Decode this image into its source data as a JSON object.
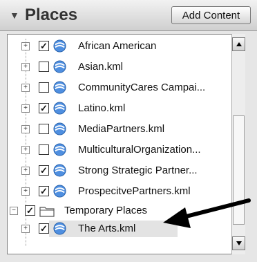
{
  "header": {
    "toggle_icon": "triangle-down-icon",
    "title": "Places",
    "add_content_label": "Add Content"
  },
  "items": [
    {
      "label": "African American",
      "checked": true,
      "icon": "globe-icon"
    },
    {
      "label": "Asian.kml",
      "checked": false,
      "icon": "globe-icon"
    },
    {
      "label": "CommunityCares Campai...",
      "checked": false,
      "icon": "globe-icon"
    },
    {
      "label": "Latino.kml",
      "checked": true,
      "icon": "globe-icon"
    },
    {
      "label": "MediaPartners.kml",
      "checked": false,
      "icon": "globe-icon"
    },
    {
      "label": "MulticulturalOrganization...",
      "checked": false,
      "icon": "globe-icon"
    },
    {
      "label": "Strong Strategic Partner...",
      "checked": true,
      "icon": "globe-icon"
    },
    {
      "label": "ProspecitvePartners.kml",
      "checked": true,
      "icon": "globe-icon"
    },
    {
      "label": "Temporary Places",
      "checked": true,
      "icon": "folder-icon"
    },
    {
      "label": "The Arts.kml",
      "checked": true,
      "icon": "globe-icon",
      "selected": true
    }
  ],
  "scroll": {
    "up_icon": "arrow-up-icon",
    "down_icon": "arrow-down-icon"
  },
  "annotation": {
    "icon": "pointer-arrow-icon"
  }
}
